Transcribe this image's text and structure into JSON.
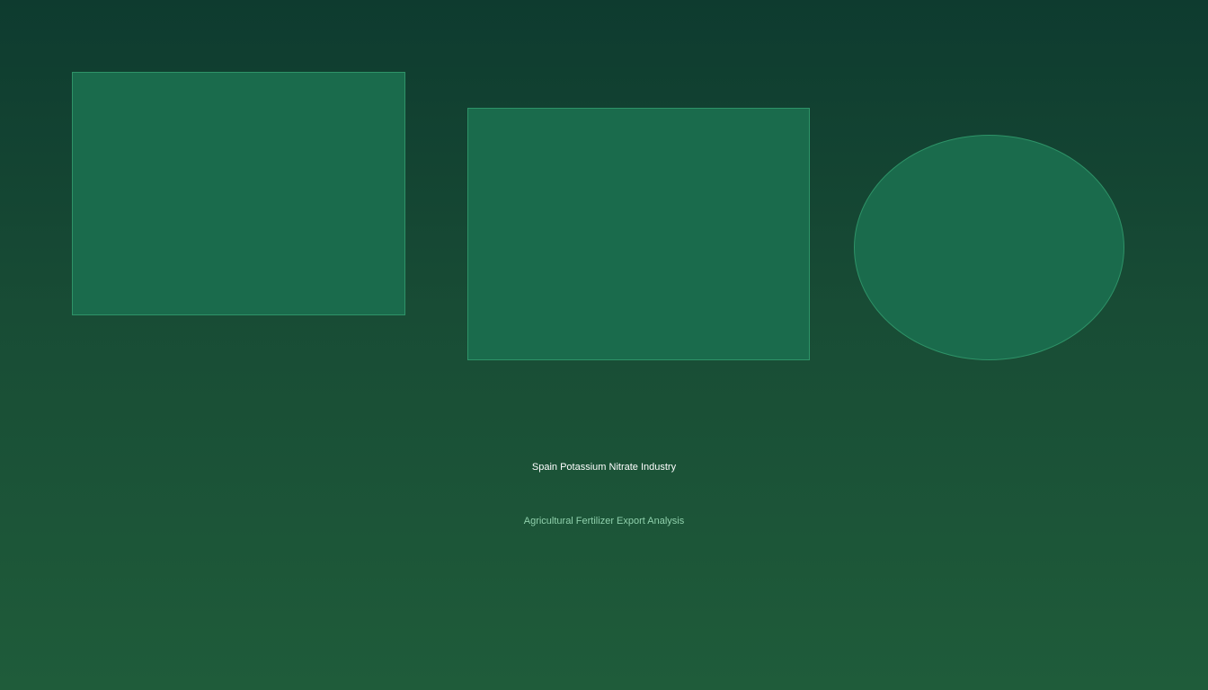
{
  "colors": {
    "background_top": "#0e3b2f",
    "background_bottom": "#1f5c3a",
    "shape_fill": "#1a6b4c",
    "shape_border": "#2e9368",
    "title_text": "#ffffff",
    "subtitle_text": "#8fd0ac"
  },
  "hero": {
    "title": "Spain Potassium Nitrate Industry",
    "subtitle": "Agricultural Fertilizer Export Analysis"
  }
}
